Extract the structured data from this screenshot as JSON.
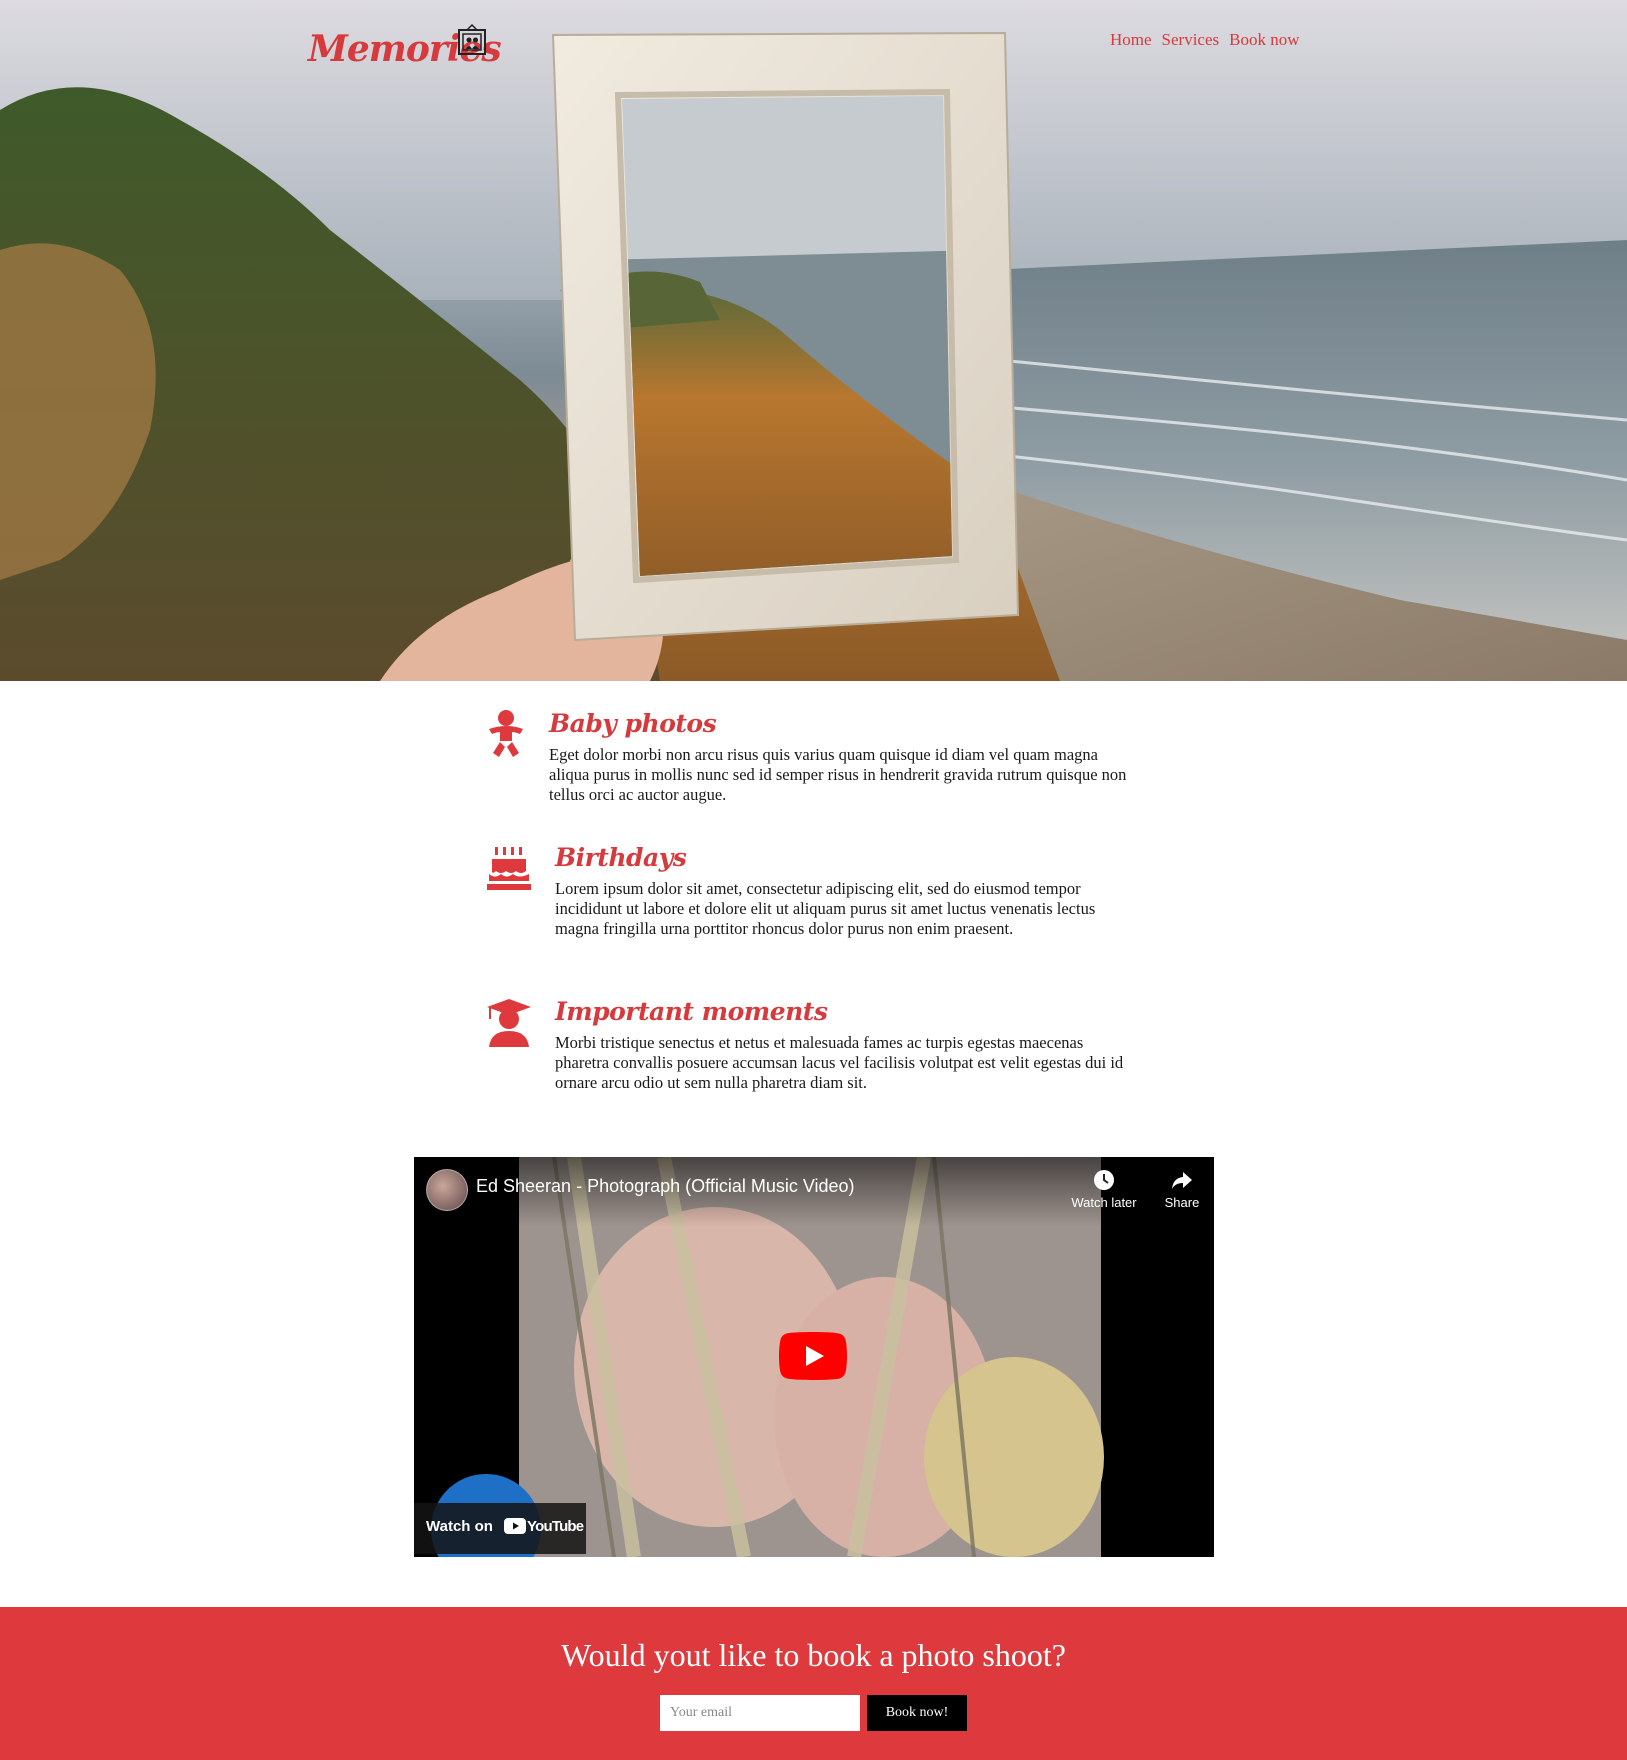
{
  "header": {
    "logo_text": "Memories",
    "nav": [
      {
        "label": "Home"
      },
      {
        "label": "Services"
      },
      {
        "label": "Book now"
      }
    ]
  },
  "hero": {
    "image": "hand holding empty picture frame over coastal cliff and ocean"
  },
  "features": [
    {
      "icon": "baby-icon",
      "title": "Baby photos",
      "text": "Eget dolor morbi non arcu risus quis varius quam quisque id diam vel quam magna aliqua purus in mollis nunc sed id semper risus in hendrerit gravida rutrum quisque non tellus orci ac auctor augue."
    },
    {
      "icon": "birthday-cake-icon",
      "title": "Birthdays",
      "text": "Lorem ipsum dolor sit amet, consectetur adipiscing elit, sed do eiusmod tempor incididunt ut labore et dolore elit ut aliquam purus sit amet luctus venenatis lectus magna fringilla urna porttitor rhoncus dolor purus non enim praesent."
    },
    {
      "icon": "graduate-icon",
      "title": "Important moments",
      "text": "Morbi tristique senectus et netus et malesuada fames ac turpis egestas maecenas pharetra convallis posuere accumsan lacus vel facilisis volutpat est velit egestas dui id ornare arcu odio ut sem nulla pharetra diam sit."
    }
  ],
  "video": {
    "title": "Ed Sheeran - Photograph (Official Music Video)",
    "watch_later": "Watch later",
    "share": "Share",
    "watch_on": "Watch on",
    "brand": "YouTube"
  },
  "cta": {
    "heading": "Would yout like to book a photo shoot?",
    "email_placeholder": "Your email",
    "button_label": "Book now!"
  },
  "colors": {
    "accent": "#de3a3d",
    "text": "#1a1a1a"
  }
}
